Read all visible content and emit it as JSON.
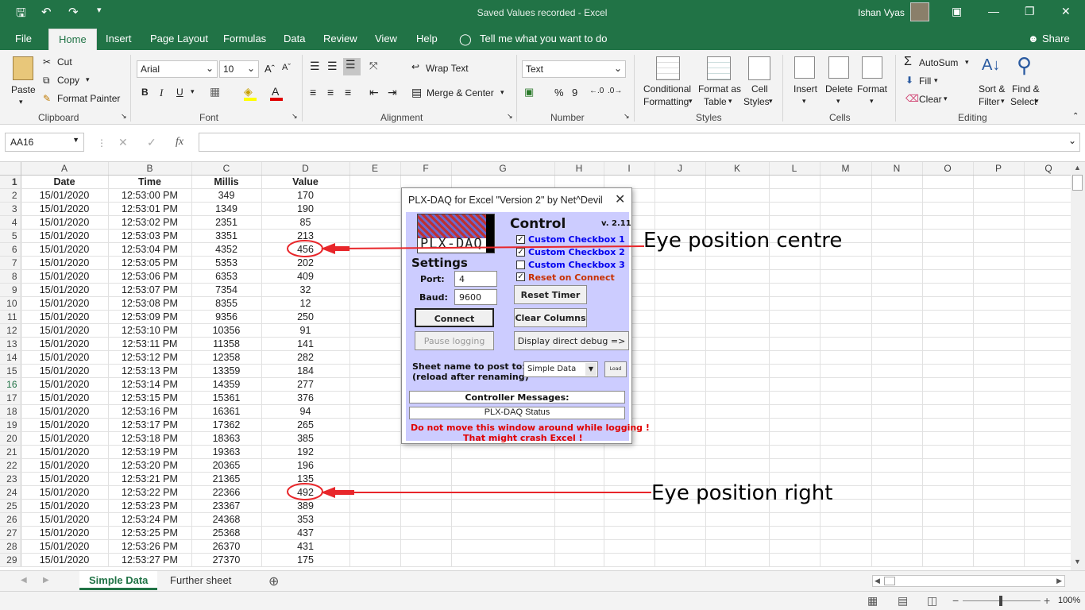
{
  "window": {
    "title": "Saved Values recorded  -  Excel",
    "user": "Ishan Vyas"
  },
  "tabs": [
    "File",
    "Home",
    "Insert",
    "Page Layout",
    "Formulas",
    "Data",
    "Review",
    "View",
    "Help"
  ],
  "tell_me": "Tell me what you want to do",
  "share": "Share",
  "ribbon": {
    "clipboard": {
      "paste": "Paste",
      "cut": "Cut",
      "copy": "Copy",
      "format_painter": "Format Painter",
      "label": "Clipboard"
    },
    "font": {
      "name": "Arial",
      "size": "10",
      "bold": "B",
      "italic": "I",
      "underline": "U",
      "label": "Font"
    },
    "alignment": {
      "wrap": "Wrap Text",
      "merge": "Merge & Center",
      "label": "Alignment"
    },
    "number": {
      "format": "Text",
      "percent": "%",
      "comma": "9",
      "label": "Number"
    },
    "styles": {
      "conditional": "Conditional",
      "conditional2": "Formatting",
      "format_table": "Format as",
      "format_table2": "Table",
      "cell_styles": "Cell",
      "cell_styles2": "Styles",
      "label": "Styles"
    },
    "cells": {
      "insert": "Insert",
      "delete": "Delete",
      "format": "Format",
      "label": "Cells"
    },
    "editing": {
      "autosum": "AutoSum",
      "fill": "Fill",
      "clear": "Clear",
      "sort": "Sort &",
      "sort2": "Filter",
      "find": "Find &",
      "find2": "Select",
      "label": "Editing"
    }
  },
  "name_box": "AA16",
  "columns": [
    "A",
    "B",
    "C",
    "D",
    "E",
    "F",
    "G",
    "H",
    "I",
    "J",
    "K",
    "L",
    "M",
    "N",
    "O",
    "P",
    "Q"
  ],
  "header_row": [
    "Date",
    "Time",
    "Millis",
    "Value"
  ],
  "rows": [
    [
      "15/01/2020",
      "12:53:00 PM",
      "349",
      "170"
    ],
    [
      "15/01/2020",
      "12:53:01 PM",
      "1349",
      "190"
    ],
    [
      "15/01/2020",
      "12:53:02 PM",
      "2351",
      "85"
    ],
    [
      "15/01/2020",
      "12:53:03 PM",
      "3351",
      "213"
    ],
    [
      "15/01/2020",
      "12:53:04 PM",
      "4352",
      "456"
    ],
    [
      "15/01/2020",
      "12:53:05 PM",
      "5353",
      "202"
    ],
    [
      "15/01/2020",
      "12:53:06 PM",
      "6353",
      "409"
    ],
    [
      "15/01/2020",
      "12:53:07 PM",
      "7354",
      "32"
    ],
    [
      "15/01/2020",
      "12:53:08 PM",
      "8355",
      "12"
    ],
    [
      "15/01/2020",
      "12:53:09 PM",
      "9356",
      "250"
    ],
    [
      "15/01/2020",
      "12:53:10 PM",
      "10356",
      "91"
    ],
    [
      "15/01/2020",
      "12:53:11 PM",
      "11358",
      "141"
    ],
    [
      "15/01/2020",
      "12:53:12 PM",
      "12358",
      "282"
    ],
    [
      "15/01/2020",
      "12:53:13 PM",
      "13359",
      "184"
    ],
    [
      "15/01/2020",
      "12:53:14 PM",
      "14359",
      "277"
    ],
    [
      "15/01/2020",
      "12:53:15 PM",
      "15361",
      "376"
    ],
    [
      "15/01/2020",
      "12:53:16 PM",
      "16361",
      "94"
    ],
    [
      "15/01/2020",
      "12:53:17 PM",
      "17362",
      "265"
    ],
    [
      "15/01/2020",
      "12:53:18 PM",
      "18363",
      "385"
    ],
    [
      "15/01/2020",
      "12:53:19 PM",
      "19363",
      "192"
    ],
    [
      "15/01/2020",
      "12:53:20 PM",
      "20365",
      "196"
    ],
    [
      "15/01/2020",
      "12:53:21 PM",
      "21365",
      "135"
    ],
    [
      "15/01/2020",
      "12:53:22 PM",
      "22366",
      "492"
    ],
    [
      "15/01/2020",
      "12:53:23 PM",
      "23367",
      "389"
    ],
    [
      "15/01/2020",
      "12:53:24 PM",
      "24368",
      "353"
    ],
    [
      "15/01/2020",
      "12:53:25 PM",
      "25368",
      "437"
    ],
    [
      "15/01/2020",
      "12:53:26 PM",
      "26370",
      "431"
    ],
    [
      "15/01/2020",
      "12:53:27 PM",
      "27370",
      "175"
    ]
  ],
  "sheets": [
    "Simple Data",
    "Further sheet"
  ],
  "zoom": "100%",
  "dialog": {
    "title": "PLX-DAQ for Excel \"Version 2\" by Net^Devil",
    "logo_text": "PLX-DAQ",
    "control": "Control",
    "version": "v. 2.11",
    "checkboxes": [
      {
        "label": "Custom Checkbox 1",
        "checked": true
      },
      {
        "label": "Custom Checkbox 2",
        "checked": true
      },
      {
        "label": "Custom Checkbox 3",
        "checked": false
      },
      {
        "label": "Reset on Connect",
        "checked": true
      }
    ],
    "settings": "Settings",
    "port_label": "Port:",
    "port": "4",
    "baud_label": "Baud:",
    "baud": "9600",
    "reset_timer": "Reset Timer",
    "connect": "Connect",
    "clear_columns": "Clear Columns",
    "pause_logging": "Pause logging",
    "display_debug": "Display direct debug =>",
    "sheet_label1": "Sheet name to post to:",
    "sheet_label2": "(reload after renaming)",
    "sheet_select": "Simple Data",
    "load": "Load",
    "controller_messages": "Controller Messages:",
    "status": "PLX-DAQ Status",
    "warning1": "Do not move this window around while logging !",
    "warning2": "That might crash Excel !"
  },
  "annotations": {
    "centre": "Eye position centre",
    "right": "Eye position right"
  },
  "colors": {
    "excel_green": "#217346",
    "annotation_red": "#e8262a",
    "dialog_bg": "#ccccff"
  }
}
